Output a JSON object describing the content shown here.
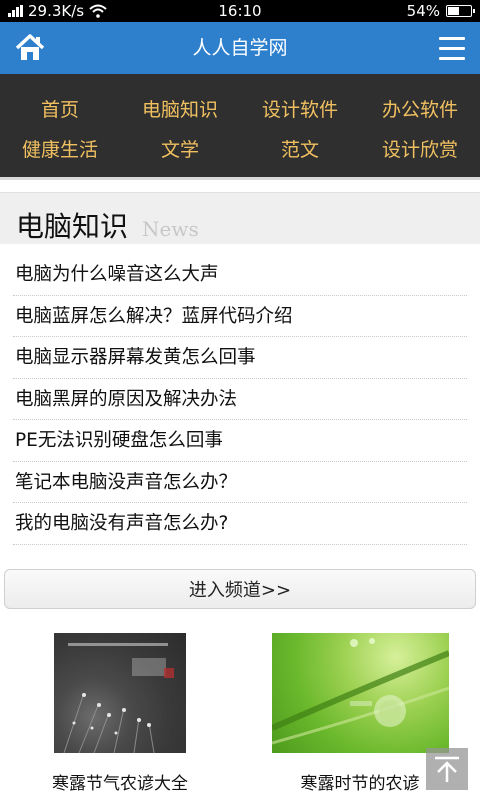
{
  "status_bar": {
    "network_speed": "29.3K/s",
    "time": "16:10",
    "battery_text": "54%",
    "battery_level": 0.54
  },
  "header": {
    "title": "人人自学网",
    "home_icon": "home-icon",
    "menu_icon": "menu-icon"
  },
  "nav": {
    "items": [
      "首页",
      "电脑知识",
      "设计软件",
      "办公软件",
      "健康生活",
      "文学",
      "范文",
      "设计欣赏"
    ]
  },
  "section": {
    "title": "电脑知识",
    "subtitle": "News"
  },
  "articles": [
    "电脑为什么噪音这么大声",
    "电脑蓝屏怎么解决？蓝屏代码介绍",
    "电脑显示器屏幕发黄怎么回事",
    "电脑黑屏的原因及解决办法",
    "PE无法识别硬盘怎么回事",
    "笔记本电脑没声音怎么办？",
    "我的电脑没有声音怎么办?"
  ],
  "enter_channel": "进入频道>>",
  "thumbnails": [
    {
      "caption": "寒露节气农谚大全"
    },
    {
      "caption": "寒露时节的农谚"
    }
  ],
  "colors": {
    "header_bg": "#2e80cd",
    "nav_bg": "#2f2f2f",
    "nav_text": "#f0c060"
  }
}
